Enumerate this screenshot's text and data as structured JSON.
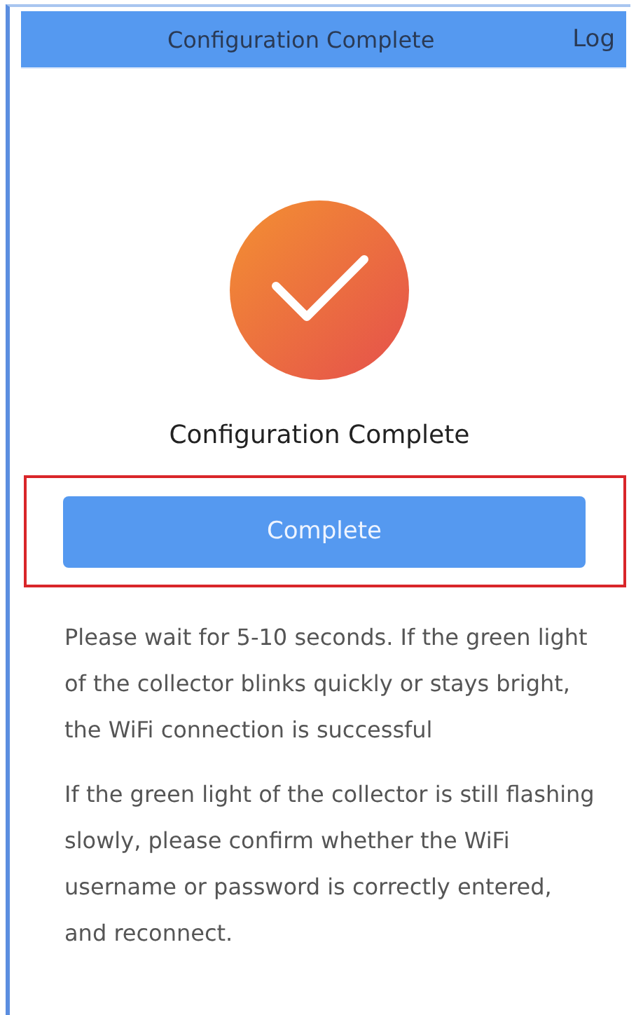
{
  "header": {
    "title": "Configuration Complete",
    "action": "Log"
  },
  "status": {
    "heading": "Configuration Complete"
  },
  "complete_button": {
    "label": "Complete",
    "highlighted": true
  },
  "paragraphs": [
    "Please wait for 5-10 seconds. If the green light of the collector blinks quickly or stays bright, the WiFi connection is successful",
    "If the green light of the collector is still flashing slowly, please confirm whether the WiFi username or password is correctly entered, and reconnect."
  ]
}
